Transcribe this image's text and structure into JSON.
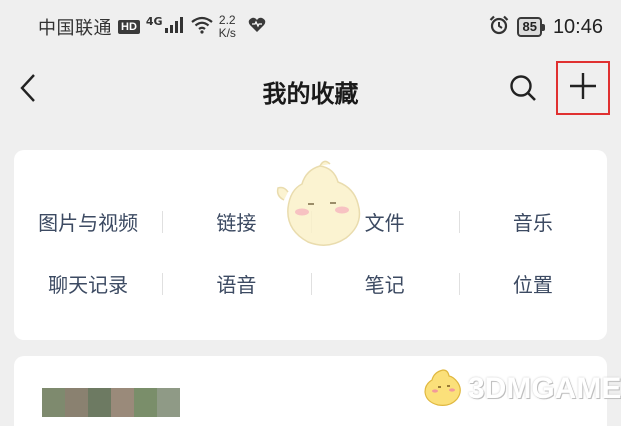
{
  "status_bar": {
    "carrier": "中国联通",
    "hd_badge": "HD",
    "network_type": "4G",
    "speed_value": "2.2",
    "speed_unit": "K/s",
    "battery_level": "85",
    "time": "10:46",
    "icons": [
      "signal-bars-icon",
      "wifi-icon",
      "heart-icon",
      "alarm-icon",
      "battery-icon"
    ]
  },
  "header": {
    "title": "我的收藏",
    "back_icon": "chevron-left-icon",
    "search_icon": "search-icon",
    "add_icon": "plus-icon",
    "highlight_color": "#e03030"
  },
  "categories": {
    "rows": [
      [
        "图片与视频",
        "链接",
        "文件",
        "音乐"
      ],
      [
        "聊天记录",
        "语音",
        "笔记",
        "位置"
      ]
    ],
    "label_color": "#3c4a62"
  },
  "watermark": {
    "site": "3DMGAME"
  },
  "thumbnail_colors": [
    "#7e8a6e",
    "#8a8170",
    "#6d7a62",
    "#9a8a7a",
    "#7a8e6a",
    "#8f9a86"
  ]
}
